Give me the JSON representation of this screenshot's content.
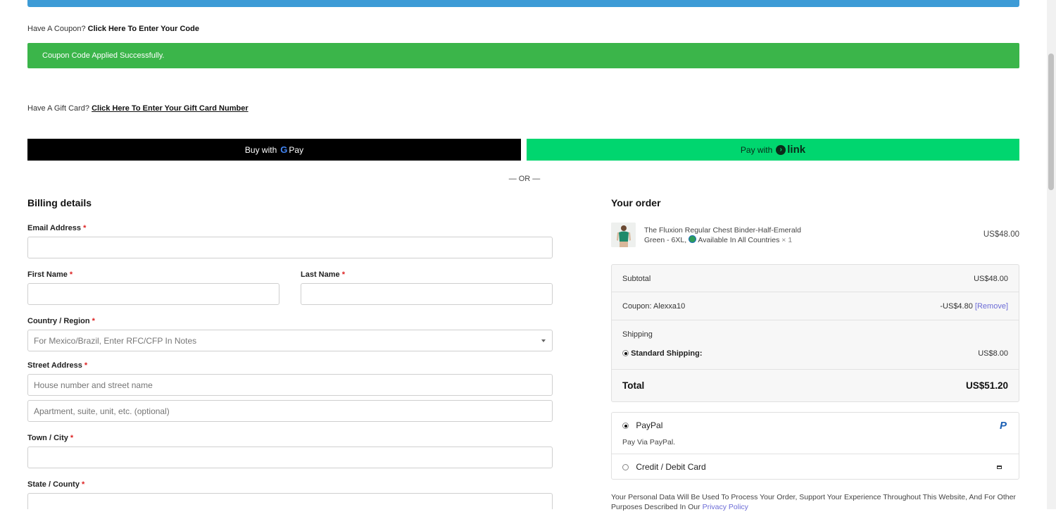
{
  "coupon": {
    "prompt": "Have A Coupon?",
    "link": "Click Here To Enter Your Code",
    "success": "Coupon Code Applied Successfully."
  },
  "gift_card": {
    "prompt": "Have A Gift Card?",
    "link": "Click Here To Enter Your Gift Card Number"
  },
  "express": {
    "gpay_prefix": "Buy with",
    "gpay_g": "G",
    "gpay_word": "Pay",
    "link_prefix": "Pay with",
    "link_word": "link",
    "or": "— OR —"
  },
  "billing": {
    "title": "Billing details",
    "required_marker": "*",
    "email_label": "Email Address",
    "first_name_label": "First Name",
    "last_name_label": "Last Name",
    "country_label": "Country / Region",
    "country_placeholder": "For Mexico/Brazil, Enter RFC/CFP In Notes",
    "street_label": "Street Address",
    "street_placeholder_1": "House number and street name",
    "street_placeholder_2": "Apartment, suite, unit, etc. (optional)",
    "city_label": "Town / City",
    "state_label": "State / County"
  },
  "order": {
    "title": "Your order",
    "product": {
      "name": "The Fluxion Regular Chest Binder-Half-Emerald",
      "variant": "Green - 6XL,",
      "availability": "Available In All Countries",
      "qty": "× 1",
      "price": "US$48.00"
    },
    "subtotal_label": "Subtotal",
    "subtotal_value": "US$48.00",
    "coupon_label": "Coupon: Alexxa10",
    "coupon_value": "-US$4.80",
    "coupon_remove": "[Remove]",
    "shipping_label": "Shipping",
    "shipping_method": "Standard Shipping:",
    "shipping_value": "US$8.00",
    "total_label": "Total",
    "total_value": "US$51.20"
  },
  "payment": {
    "paypal_label": "PayPal",
    "paypal_desc": "Pay Via PayPal.",
    "card_label": "Credit / Debit Card"
  },
  "privacy": {
    "text": "Your Personal Data Will Be Used To Process Your Order, Support Your Experience Throughout This Website, And For Other Purposes Described In Our",
    "link": "Privacy Policy"
  },
  "colors": {
    "top_bar": "#3d9bd6",
    "success": "#3bb54a",
    "link_green": "#00d66f",
    "accent_link": "#6b6bd6"
  },
  "icons": [
    "google-g-icon",
    "link-arrow-icon",
    "globe-icon",
    "paypal-icon",
    "credit-card-icon",
    "dropdown-caret-icon"
  ]
}
